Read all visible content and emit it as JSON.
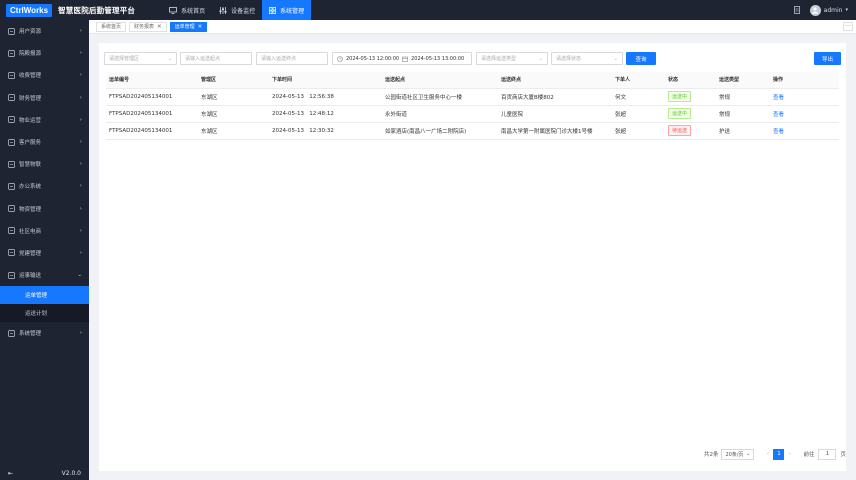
{
  "header": {
    "logo": "CtrlWorks",
    "title": "智慧医院后勤管理平台",
    "nav": [
      {
        "label": "系统首页",
        "icon": "monitor-icon"
      },
      {
        "label": "设备监控",
        "icon": "sliders-icon"
      },
      {
        "label": "系统管理",
        "icon": "grid-icon"
      }
    ],
    "active_nav": "系统管理",
    "user": "admin"
  },
  "sidebar": {
    "items": [
      {
        "label": "用户资源",
        "icon": "folder-icon"
      },
      {
        "label": "院殿报源",
        "icon": "users-icon"
      },
      {
        "label": "收费管理",
        "icon": "coin-icon"
      },
      {
        "label": "财务管理",
        "icon": "wallet-icon"
      },
      {
        "label": "物业运营",
        "icon": "building-icon"
      },
      {
        "label": "客户服务",
        "icon": "headset-icon"
      },
      {
        "label": "智慧物联",
        "icon": "chip-icon"
      },
      {
        "label": "办公系统",
        "icon": "briefcase-icon"
      },
      {
        "label": "物资管理",
        "icon": "box-icon"
      },
      {
        "label": "社区电商",
        "icon": "cart-icon"
      },
      {
        "label": "党建管理",
        "icon": "flag-icon"
      },
      {
        "label": "运事输送",
        "icon": "truck-icon"
      }
    ],
    "sub_items": [
      {
        "label": "运单管理"
      },
      {
        "label": "运送计划"
      }
    ],
    "last_item": {
      "label": "系统管理",
      "icon": "gear-icon"
    },
    "footer_version": "V2.0.0"
  },
  "tabs": [
    {
      "label": "系统首页",
      "closable": false
    },
    {
      "label": "财务报表",
      "closable": true
    },
    {
      "label": "运单管理",
      "closable": true
    }
  ],
  "filters": {
    "area_placeholder": "请选择管理区",
    "start_placeholder": "请输入运送起点",
    "end_placeholder": "请输入运送终点",
    "date_start": "2024-05-13 12:00:00",
    "date_end": "2024-05-13 13:00:00",
    "type_placeholder": "请选择运送类型",
    "status_placeholder": "请选择状态",
    "search_label": "查询",
    "export_label": "导出"
  },
  "table": {
    "columns": [
      "运单编号",
      "管理区",
      "下单时间",
      "运送起点",
      "运送终点",
      "下单人",
      "状态",
      "运送类型",
      "操作"
    ],
    "rows": [
      {
        "id": "FTPSAD202405134001",
        "area": "东湖区",
        "time": "2024-05-13   12:56:38",
        "from": "公园街道社区卫生服务中心一楼",
        "to": "百货商店大厦B楼802",
        "person": "何文",
        "status": "运送中",
        "status_color": "#52c41a",
        "type": "常规",
        "action": "查看"
      },
      {
        "id": "FTPSAD202405134001",
        "area": "东湖区",
        "time": "2024-05-13   12:48:12",
        "from": "永外街道",
        "to": "儿童医院",
        "person": "张超",
        "status": "运送中",
        "status_color": "#52c41a",
        "type": "常规",
        "action": "查看"
      },
      {
        "id": "FTPSAD202405134001",
        "area": "东湖区",
        "time": "2024-05-13   12:30:32",
        "from": "如家酒店(南昌八一广场二附院店)",
        "to": "南昌大学第一附属医院门诊大楼1号楼",
        "person": "张超",
        "status": "待运送",
        "status_color": "#ff4d4f",
        "type": "护送",
        "action": "查看"
      }
    ]
  },
  "pagination": {
    "total": "共2条",
    "page_size": "20条/页",
    "current": "1",
    "goto_label": "前往",
    "goto_value": "1",
    "page_unit": "页"
  },
  "colors": {
    "primary": "#1677ff",
    "sidebar": "#1f2433",
    "topbar": "#1f2433"
  }
}
